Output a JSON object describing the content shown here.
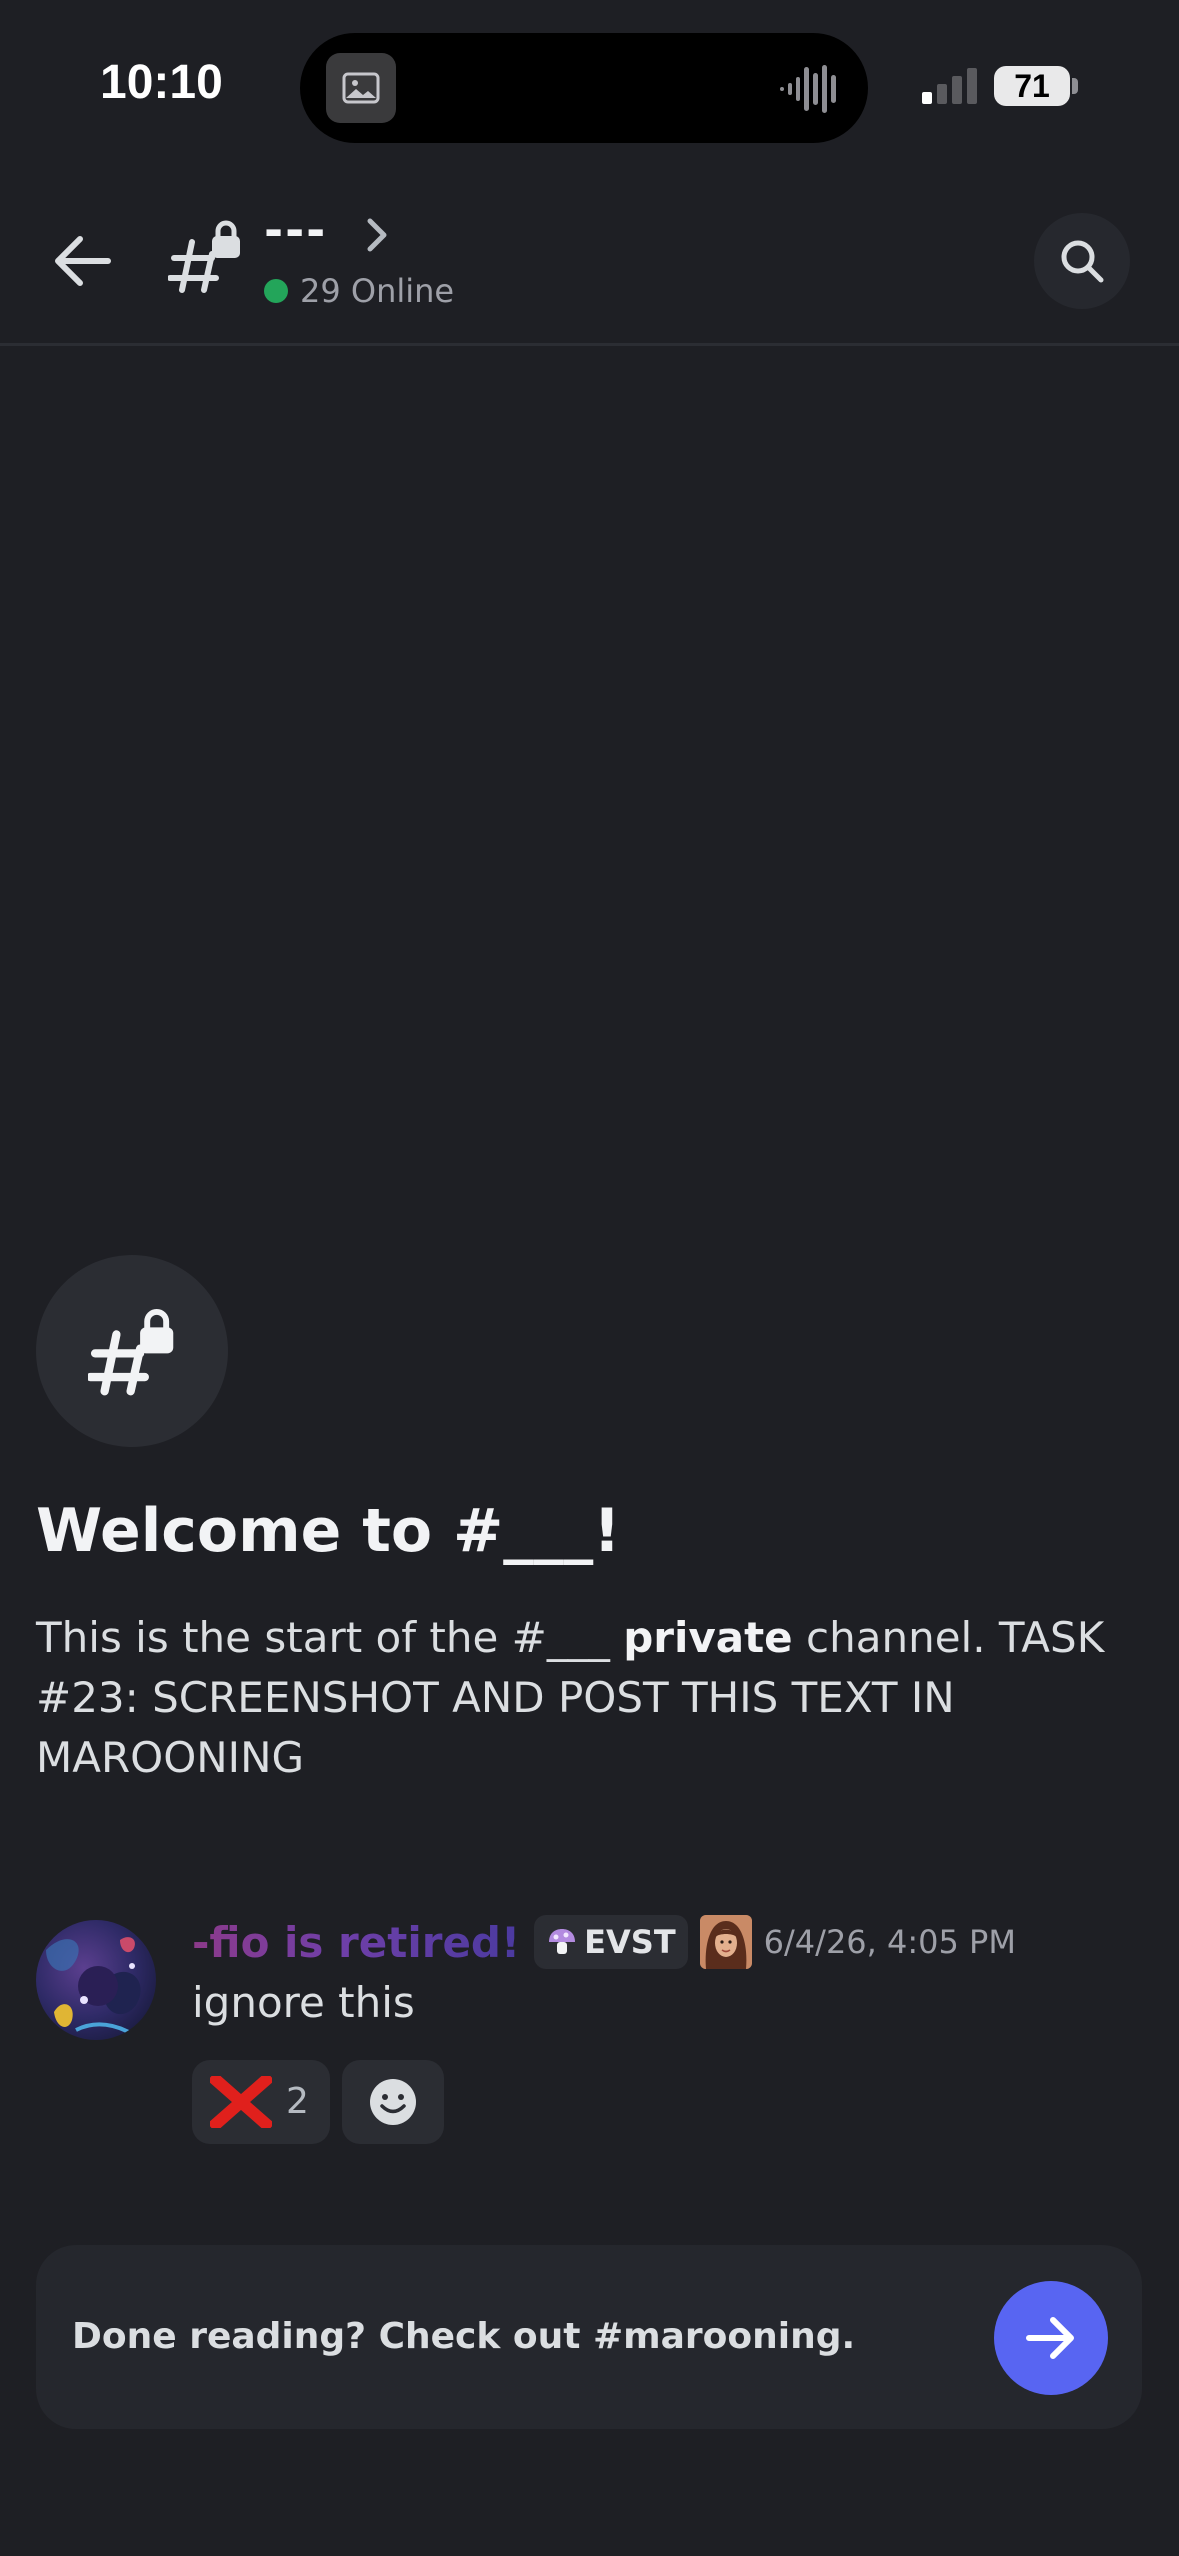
{
  "status_bar": {
    "time": "10:10",
    "battery": "71",
    "icons": [
      "photo-icon",
      "voice-waveform-icon",
      "cellular-signal-icon",
      "battery-icon"
    ]
  },
  "header": {
    "channel_name": "---",
    "online_count": "29 Online",
    "online_color": "#23a55a",
    "icons": [
      "back-arrow-icon",
      "private-channel-icon",
      "chevron-right-icon",
      "search-icon"
    ]
  },
  "welcome": {
    "title": "Welcome to #___!",
    "desc_prefix": "This is the start of the #___ ",
    "desc_bold": "private",
    "desc_suffix": " channel. TASK #23: SCREENSHOT AND POST THIS TEXT IN MAROONING"
  },
  "message": {
    "author": "-fio is retired!",
    "tag": "EVST",
    "timestamp": "6/4/26, 4:05 PM",
    "text": "ignore this",
    "reactions": [
      {
        "emoji": "cross-mark-icon",
        "count": "2"
      },
      {
        "emoji": "add-reaction-icon"
      }
    ]
  },
  "banner": {
    "text": "Done reading? Check out #marooning.",
    "accent": "#5865f2"
  }
}
